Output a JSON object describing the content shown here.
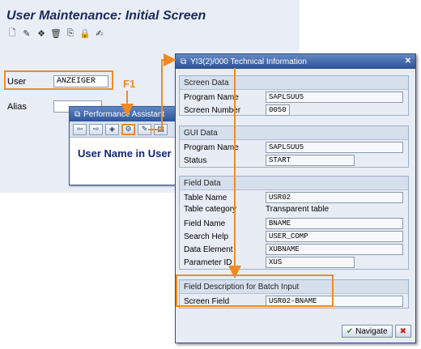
{
  "main": {
    "title": "User Maintenance: Initial Screen",
    "toolbar_icons": [
      "new-icon",
      "edit-icon",
      "display-icon",
      "delete-icon",
      "copy-icon",
      "lock-icon",
      "change-password-icon"
    ],
    "user_label": "User",
    "user_value": "ANZEIGER",
    "alias_label": "Alias",
    "alias_value": "",
    "f1_label": "F1"
  },
  "performance_assistant": {
    "title": "Performance Assistant",
    "heading": "User Name in User"
  },
  "tech_info": {
    "title": "YI3(2)/000 Technical Information",
    "screen_data": {
      "title": "Screen Data",
      "program_name_label": "Program Name",
      "program_name": "SAPLSUU5",
      "screen_number_label": "Screen Number",
      "screen_number": "0050"
    },
    "gui_data": {
      "title": "GUI Data",
      "program_name_label": "Program Name",
      "program_name": "SAPLSUU5",
      "status_label": "Status",
      "status": "START"
    },
    "field_data": {
      "title": "Field Data",
      "table_name_label": "Table Name",
      "table_name": "USR02",
      "table_category_label": "Table category",
      "table_category": "Transparent table",
      "field_name_label": "Field Name",
      "field_name": "BNAME",
      "search_help_label": "Search Help",
      "search_help": "USER_COMP",
      "data_element_label": "Data Element",
      "data_element": "XUBNAME",
      "parameter_id_label": "Parameter ID",
      "parameter_id": "XUS"
    },
    "batch_input": {
      "title": "Field Description for Batch Input",
      "screen_field_label": "Screen Field",
      "screen_field": "USR02-BNAME"
    },
    "navigate_label": "Navigate"
  },
  "colors": {
    "highlight": "#f08a24",
    "title_blue": "#1a2a5c"
  }
}
